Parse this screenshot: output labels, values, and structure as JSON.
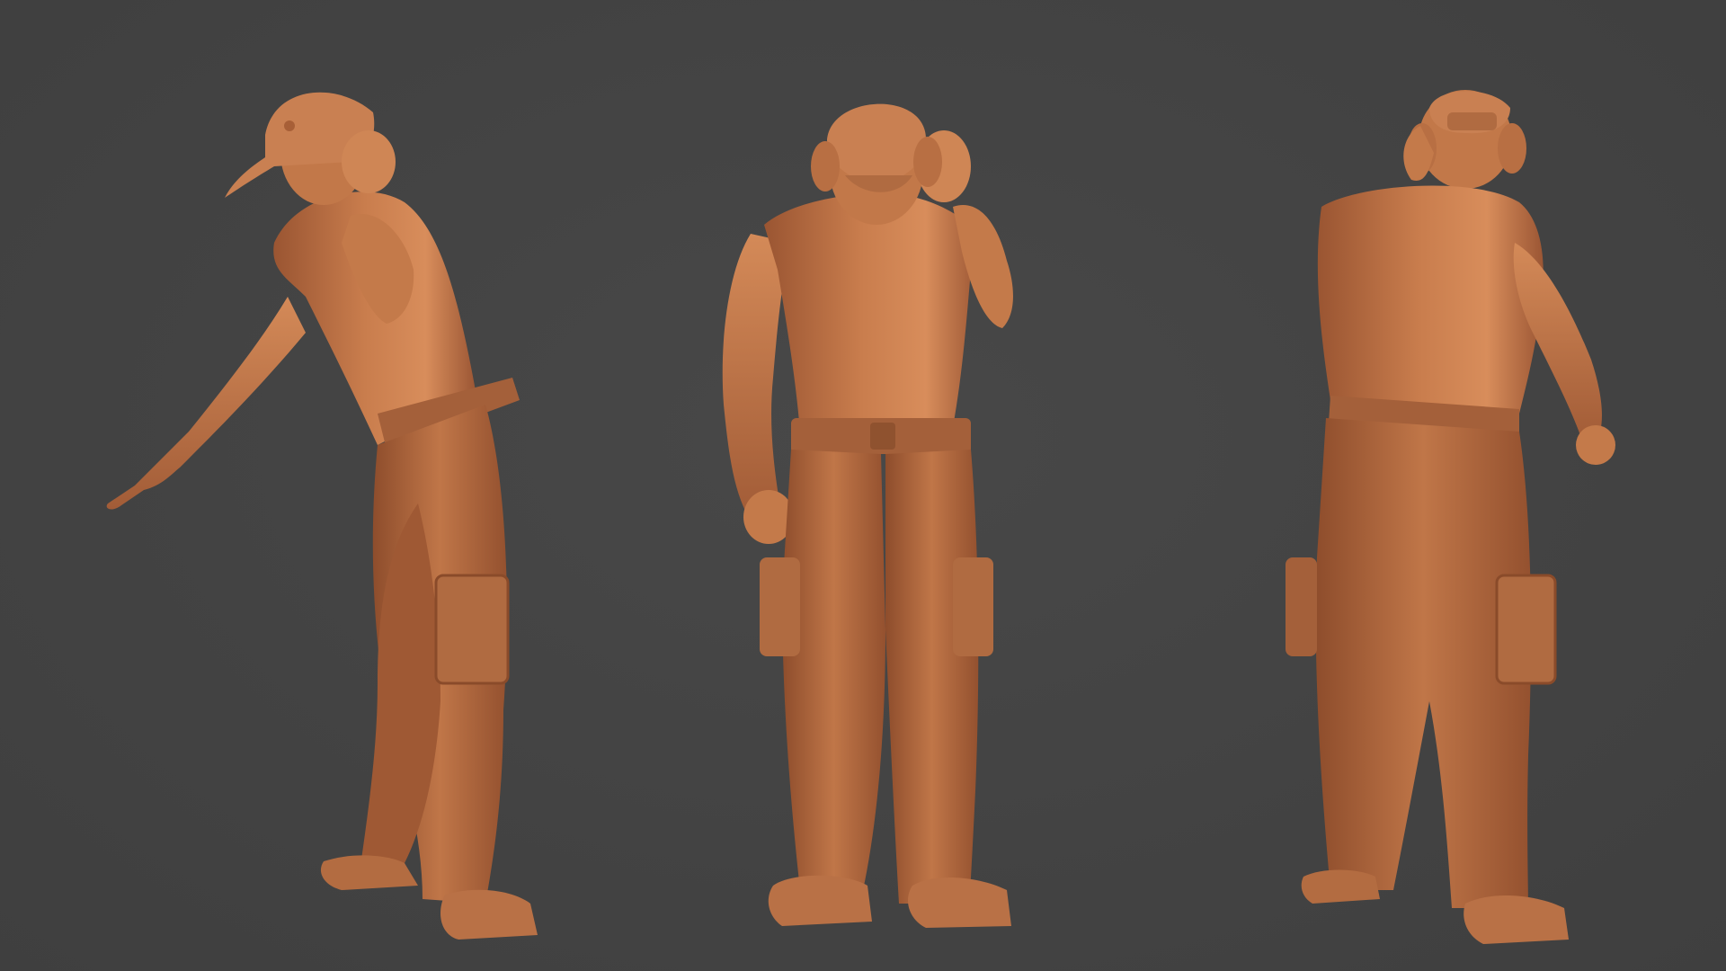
{
  "scene": {
    "background_color": "#434343",
    "material_color": "#c2784a",
    "material_shadow": "#8a4b2a",
    "material_highlight": "#e49a68"
  },
  "figures": [
    {
      "view": "side",
      "icon": "pointing-figure"
    },
    {
      "view": "front",
      "icon": "pointing-figure"
    },
    {
      "view": "back",
      "icon": "pointing-figure"
    }
  ]
}
